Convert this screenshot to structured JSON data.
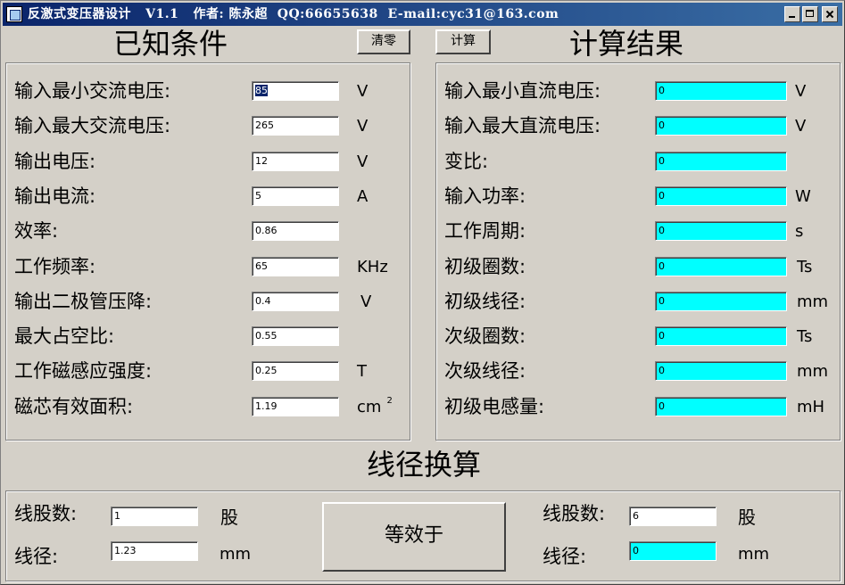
{
  "window": {
    "title": "反激式变压器设计   V1.1   作者: 陈永超  QQ:66655638  E-mail:cyc31@163.com"
  },
  "known": {
    "heading": "已知条件",
    "clear_button": "清零",
    "rows": [
      {
        "label": "输入最小交流电压:",
        "value": "85",
        "unit": "V"
      },
      {
        "label": "输入最大交流电压:",
        "value": "265",
        "unit": "V"
      },
      {
        "label": "输出电压:",
        "value": "12",
        "unit": "V"
      },
      {
        "label": "输出电流:",
        "value": "5",
        "unit": "A"
      },
      {
        "label": "效率:",
        "value": "0.86",
        "unit": ""
      },
      {
        "label": "工作频率:",
        "value": "65",
        "unit": "KHz"
      },
      {
        "label": "输出二极管压降:",
        "value": "0.4",
        "unit": "V"
      },
      {
        "label": "最大占空比:",
        "value": "0.55",
        "unit": ""
      },
      {
        "label": "工作磁感应强度:",
        "value": "0.25",
        "unit": "T"
      },
      {
        "label": "磁芯有效面积:",
        "value": "1.19",
        "unit": "cm",
        "sup": "2"
      }
    ]
  },
  "results": {
    "heading": "计算结果",
    "calc_button": "计算",
    "rows": [
      {
        "label": "输入最小直流电压:",
        "value": "0",
        "unit": "V"
      },
      {
        "label": "输入最大直流电压:",
        "value": "0",
        "unit": "V"
      },
      {
        "label": "变比:",
        "value": "0",
        "unit": ""
      },
      {
        "label": "输入功率:",
        "value": "0",
        "unit": "W"
      },
      {
        "label": "工作周期:",
        "value": "0",
        "unit": "s"
      },
      {
        "label": "初级圈数:",
        "value": "0",
        "unit": "Ts"
      },
      {
        "label": "初级线径:",
        "value": "0",
        "unit": "mm"
      },
      {
        "label": "次级圈数:",
        "value": "0",
        "unit": "Ts"
      },
      {
        "label": "次级线径:",
        "value": "0",
        "unit": "mm"
      },
      {
        "label": "初级电感量:",
        "value": "0",
        "unit": "mH"
      }
    ]
  },
  "wire": {
    "heading": "线径换算",
    "equal_button": "等效于",
    "left": {
      "strands_label": "线股数:",
      "strands_value": "1",
      "strands_unit": "股",
      "dia_label": "线径:",
      "dia_value": "1.23",
      "dia_unit": "mm"
    },
    "right": {
      "strands_label": "线股数:",
      "strands_value": "6",
      "strands_unit": "股",
      "dia_label": "线径:",
      "dia_value": "0",
      "dia_unit": "mm"
    }
  },
  "colors": {
    "titlebar": "#0a246a",
    "result_field": "#00ffff",
    "face": "#d4d0c8"
  }
}
